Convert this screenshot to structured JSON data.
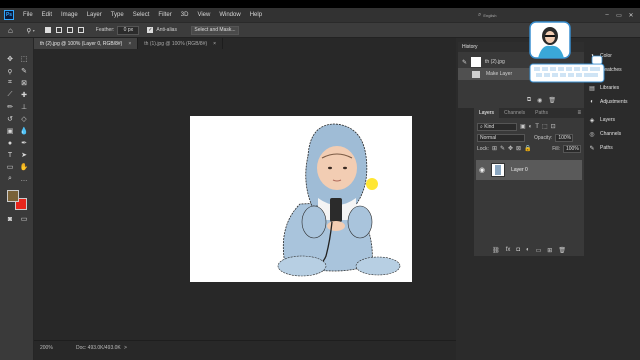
{
  "menubar": {
    "logo": "Ps",
    "items": [
      "File",
      "Edit",
      "Image",
      "Layer",
      "Type",
      "Select",
      "Filter",
      "3D",
      "View",
      "Window",
      "Help"
    ],
    "search_label": "English"
  },
  "optbar": {
    "feather_label": "Feather:",
    "feather_value": "0 px",
    "antialias_label": "Anti-alias",
    "select_mask_label": "Select and Mask..."
  },
  "tabs": [
    {
      "label": "th (2).jpg @ 100% (Layer 0, RGB/8#)",
      "close": "×"
    },
    {
      "label": "th (1).jpg @ 100% (RGB/8#)",
      "close": "×"
    }
  ],
  "status": {
    "zoom": "200%",
    "doc": "Doc: 493.0K/493.0K",
    "arrow": ">"
  },
  "history": {
    "title": "History",
    "snapshot": "th (2).jpg",
    "step": "Make Layer"
  },
  "layers": {
    "tabs": [
      "Layers",
      "Channels",
      "Paths"
    ],
    "kind": "Kind",
    "blend": "Normal",
    "opacity_label": "Opacity:",
    "opacity_value": "100%",
    "lock_label": "Lock:",
    "fill_label": "Fill:",
    "fill_value": "100%",
    "layer_name": "Layer 0"
  },
  "side_panels": [
    "Color",
    "Swatches",
    "Libraries",
    "Adjustments",
    "Layers",
    "Channels",
    "Paths"
  ],
  "colors": {
    "foreground": "#7a6238",
    "background": "#e8261c",
    "accent": "#31a8ff"
  }
}
